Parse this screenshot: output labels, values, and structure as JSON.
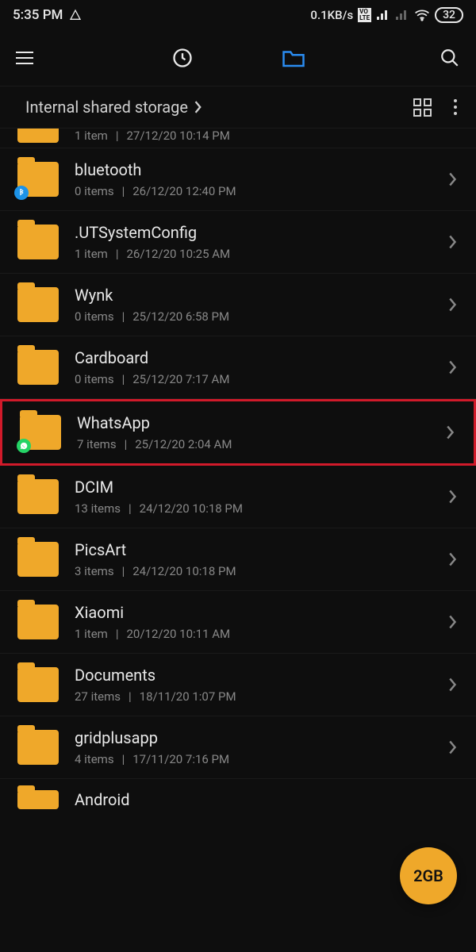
{
  "status": {
    "time": "5:35 PM",
    "netSpeed": "0.1KB/s",
    "vo": "VO LTE",
    "battery": "32"
  },
  "breadcrumb": "Internal shared storage",
  "fab": "2GB",
  "folders": [
    {
      "name": "",
      "count": "1 item",
      "date": "27/12/20 10:14 PM",
      "partialTop": true,
      "badge": ""
    },
    {
      "name": "bluetooth",
      "count": "0 items",
      "date": "26/12/20 12:40 PM",
      "badge": "bluetooth"
    },
    {
      "name": ".UTSystemConfig",
      "count": "1 item",
      "date": "26/12/20 10:25 AM",
      "badge": ""
    },
    {
      "name": "Wynk",
      "count": "0 items",
      "date": "25/12/20 6:58 PM",
      "badge": ""
    },
    {
      "name": "Cardboard",
      "count": "0 items",
      "date": "25/12/20 7:17 AM",
      "badge": ""
    },
    {
      "name": "WhatsApp",
      "count": "7 items",
      "date": "25/12/20 2:04 AM",
      "badge": "whatsapp",
      "highlight": true
    },
    {
      "name": "DCIM",
      "count": "13 items",
      "date": "24/12/20 10:18 PM",
      "badge": ""
    },
    {
      "name": "PicsArt",
      "count": "3 items",
      "date": "24/12/20 10:18 PM",
      "badge": ""
    },
    {
      "name": "Xiaomi",
      "count": "1 item",
      "date": "20/12/20 10:11 AM",
      "badge": ""
    },
    {
      "name": "Documents",
      "count": "27 items",
      "date": "18/11/20 1:07 PM",
      "badge": ""
    },
    {
      "name": "gridplusapp",
      "count": "4 items",
      "date": "17/11/20 7:16 PM",
      "badge": ""
    },
    {
      "name": "Android",
      "count": "",
      "date": "",
      "badge": "",
      "partialBottom": true
    }
  ]
}
